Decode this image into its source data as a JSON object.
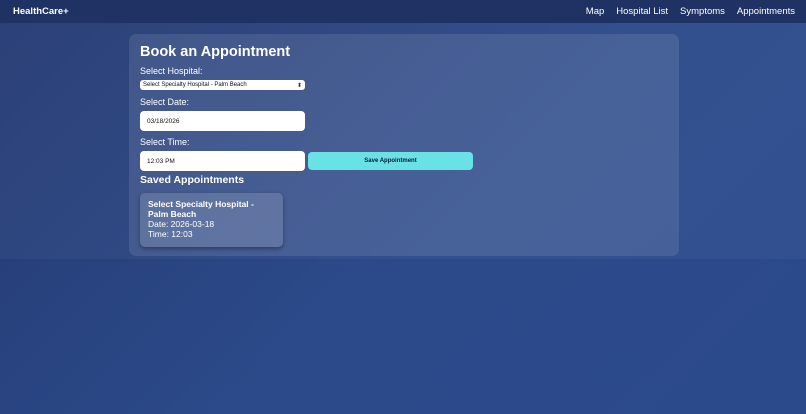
{
  "nav": {
    "brand": "HealthCare+",
    "links": [
      "Map",
      "Hospital List",
      "Symptoms",
      "Appointments"
    ]
  },
  "form": {
    "title": "Book an Appointment",
    "hospital_label": "Select Hospital:",
    "hospital_value": "Select Specialty Hospital - Palm Beach",
    "date_label": "Select Date:",
    "date_value": "03/18/2026",
    "time_label": "Select Time:",
    "time_value": "12:03 PM",
    "save_label": "Save Appointment"
  },
  "saved": {
    "title": "Saved Appointments",
    "appointments": [
      {
        "hospital": "Select Specialty Hospital - Palm Beach",
        "date": "Date: 2026-03-18",
        "time": "Time: 12:03"
      }
    ]
  },
  "colors": {
    "accent": "#69e2e6",
    "background": "#2c4a8a",
    "navbar": "#1f3263"
  },
  "icons": {
    "select_chevron": "chevron-updown-icon"
  }
}
